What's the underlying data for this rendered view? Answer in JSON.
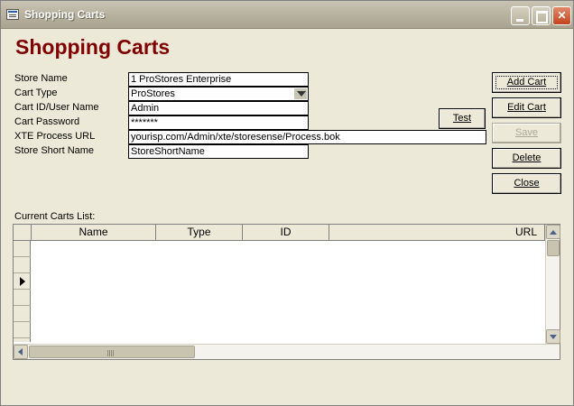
{
  "window": {
    "title": "Shopping Carts",
    "icon": "form-icon",
    "controls": [
      "minimize-icon",
      "maximize-icon",
      "close-icon"
    ]
  },
  "form": {
    "heading": "Shopping Carts",
    "heading_color": "#800000",
    "fields": {
      "store_name": {
        "label": "Store Name",
        "value": "1 ProStores Enterprise"
      },
      "cart_type": {
        "label": "Cart Type",
        "value": "ProStores"
      },
      "cart_id": {
        "label": "Cart ID/User Name",
        "value": "Admin"
      },
      "cart_password": {
        "label": "Cart Password",
        "value": "*******"
      },
      "xte_url": {
        "label": "XTE Process URL",
        "value": "yourisp.com/Admin/xte/storesense/Process.bok"
      },
      "store_short_name": {
        "label": "Store Short Name",
        "value": "StoreShortName"
      }
    }
  },
  "buttons": {
    "add_cart": "Add Cart",
    "edit_cart": "Edit Cart",
    "save": "Save",
    "delete": "Delete",
    "close": "Close",
    "test": "Test"
  },
  "list": {
    "label": "Current Carts List:",
    "columns": [
      "Name",
      "Type",
      "ID",
      "URL"
    ],
    "current_row_indicator": "record-pointer-icon"
  }
}
